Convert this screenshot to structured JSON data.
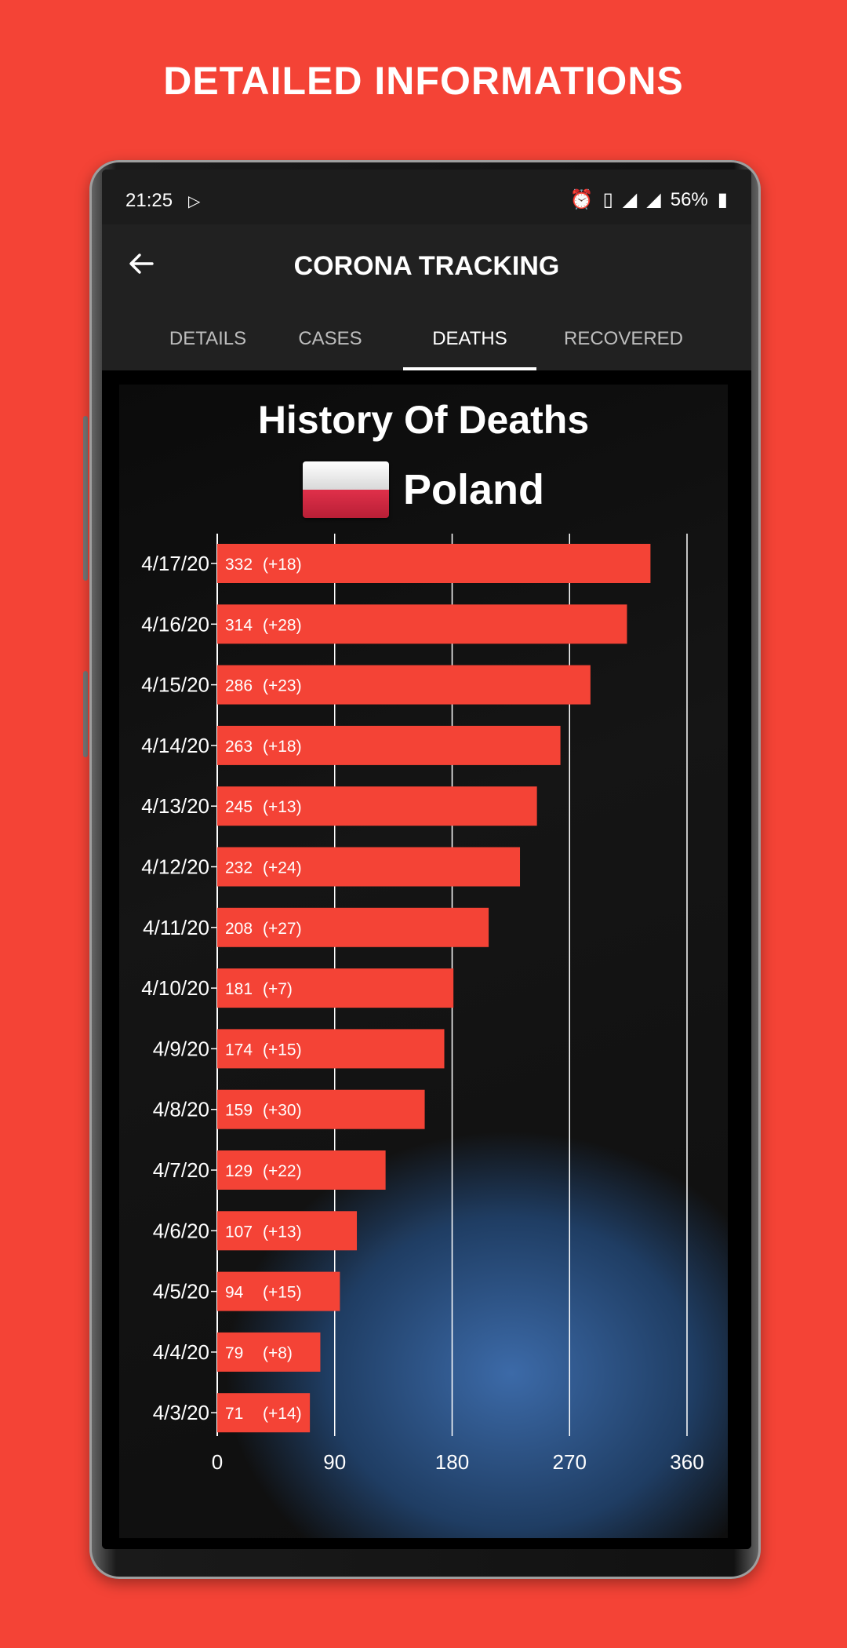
{
  "promo": {
    "title": "DETAILED INFORMATIONS"
  },
  "status_bar": {
    "time": "21:25",
    "battery": "56%"
  },
  "app_bar": {
    "title": "CORONA TRACKING",
    "back_icon": "arrow-left-icon"
  },
  "tabs": [
    {
      "label": "DETAILS",
      "active": false
    },
    {
      "label": "CASES",
      "active": false
    },
    {
      "label": "DEATHS",
      "active": true
    },
    {
      "label": "RECOVERED",
      "active": false
    }
  ],
  "card": {
    "title": "History Of Deaths",
    "country": "Poland"
  },
  "colors": {
    "bar": "#F44336",
    "background": "#F44336",
    "grid": "#ffffff"
  },
  "chart_data": {
    "type": "bar",
    "orientation": "horizontal",
    "title": "History Of Deaths",
    "categories": [
      "4/17/20",
      "4/16/20",
      "4/15/20",
      "4/14/20",
      "4/13/20",
      "4/12/20",
      "4/11/20",
      "4/10/20",
      "4/9/20",
      "4/8/20",
      "4/7/20",
      "4/6/20",
      "4/5/20",
      "4/4/20",
      "4/3/20"
    ],
    "values": [
      332,
      314,
      286,
      263,
      245,
      232,
      208,
      181,
      174,
      159,
      129,
      107,
      94,
      79,
      71
    ],
    "changes": [
      "(+18)",
      "(+28)",
      "(+23)",
      "(+18)",
      "(+13)",
      "(+24)",
      "(+27)",
      "(+7)",
      "(+15)",
      "(+30)",
      "(+22)",
      "(+13)",
      "(+15)",
      "(+8)",
      "(+14)"
    ],
    "xlim": [
      0,
      360
    ],
    "xticks": [
      0,
      90,
      180,
      270,
      360
    ],
    "grid": true
  }
}
